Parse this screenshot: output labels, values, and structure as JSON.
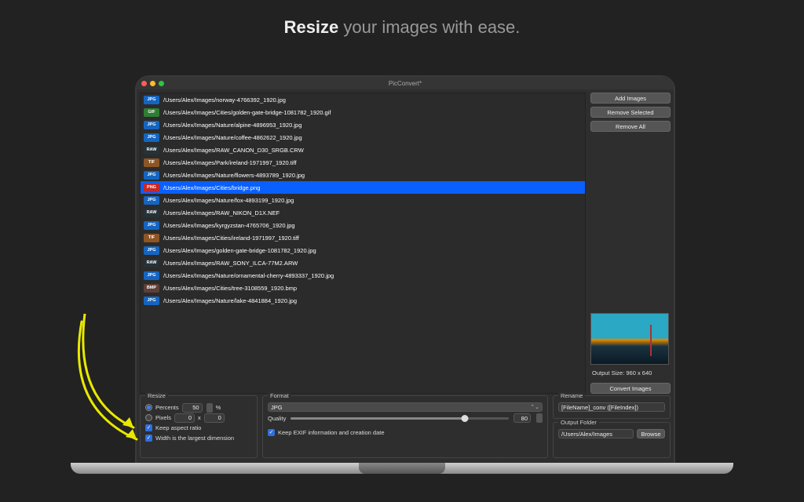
{
  "tagline": {
    "bold": "Resize",
    "rest": " your images with ease."
  },
  "window": {
    "title": "PicConvert*"
  },
  "files": [
    {
      "fmt": "JPG",
      "cls": "b-jpg",
      "path": "/Users/Alex/Images/norway-4766392_1920.jpg"
    },
    {
      "fmt": "GIF",
      "cls": "b-gif",
      "path": "/Users/Alex/Images/Cities/golden-gate-bridge-1081782_1920.gif"
    },
    {
      "fmt": "JPG",
      "cls": "b-jpg",
      "path": "/Users/Alex/Images/Nature/alpine-4896953_1920.jpg"
    },
    {
      "fmt": "JPG",
      "cls": "b-jpg",
      "path": "/Users/Alex/Images/Nature/coffee-4862622_1920.jpg"
    },
    {
      "fmt": "RAW",
      "cls": "b-raw",
      "path": "/Users/Alex/Images/RAW_CANON_D30_SRGB.CRW"
    },
    {
      "fmt": "TIF",
      "cls": "b-tif",
      "path": "/Users/Alex/Images/Park/ireland-1971997_1920.tiff"
    },
    {
      "fmt": "JPG",
      "cls": "b-jpg",
      "path": "/Users/Alex/Images/Nature/flowers-4893789_1920.jpg"
    },
    {
      "fmt": "PNG",
      "cls": "b-png",
      "path": "/Users/Alex/Images/Cities/bridge.png",
      "selected": true
    },
    {
      "fmt": "JPG",
      "cls": "b-jpg",
      "path": "/Users/Alex/Images/Nature/fox-4893199_1920.jpg"
    },
    {
      "fmt": "RAW",
      "cls": "b-raw",
      "path": "/Users/Alex/Images/RAW_NIKON_D1X.NEF"
    },
    {
      "fmt": "JPG",
      "cls": "b-jpg",
      "path": "/Users/Alex/Images/kyrgyzstan-4765706_1920.jpg"
    },
    {
      "fmt": "TIF",
      "cls": "b-tif",
      "path": "/Users/Alex/Images/Cities/ireland-1971997_1920.tiff"
    },
    {
      "fmt": "JPG",
      "cls": "b-jpg",
      "path": "/Users/Alex/Images/golden-gate-bridge-1081782_1920.jpg"
    },
    {
      "fmt": "RAW",
      "cls": "b-raw",
      "path": "/Users/Alex/Images/RAW_SONY_ILCA-77M2.ARW"
    },
    {
      "fmt": "JPG",
      "cls": "b-jpg",
      "path": "/Users/Alex/Images/Nature/ornamental-cherry-4893337_1920.jpg"
    },
    {
      "fmt": "BMP",
      "cls": "b-bmp",
      "path": "/Users/Alex/Images/Cities/tree-3108559_1920.bmp"
    },
    {
      "fmt": "JPG",
      "cls": "b-jpg",
      "path": "/Users/Alex/Images/Nature/lake-4841884_1920.jpg"
    }
  ],
  "sidebar": {
    "add": "Add Images",
    "removeSel": "Remove Selected",
    "removeAll": "Remove All",
    "outputSize": "Output Size: 960 x 640",
    "convert": "Convert Images"
  },
  "resize": {
    "legend": "Resize",
    "percentsLabel": "Percents",
    "percentsValue": "50",
    "percentSymbol": "%",
    "pixelsLabel": "Pixels",
    "pixW": "0",
    "xSym": "x",
    "pixH": "0",
    "keepRatio": "Keep aspect ratio",
    "widthLargest": "Width is the largest dimension"
  },
  "format": {
    "legend": "Format",
    "selectValue": "JPG",
    "qualityLabel": "Quality",
    "qualityValue": "80",
    "keepExif": "Keep EXIF information and creation date"
  },
  "rename": {
    "legend": "Rename",
    "pattern": "[FileName]_conv ([FileIndex])"
  },
  "outputFolder": {
    "legend": "Output Folder",
    "path": "/Users/Alex/Images",
    "browse": "Browse"
  }
}
